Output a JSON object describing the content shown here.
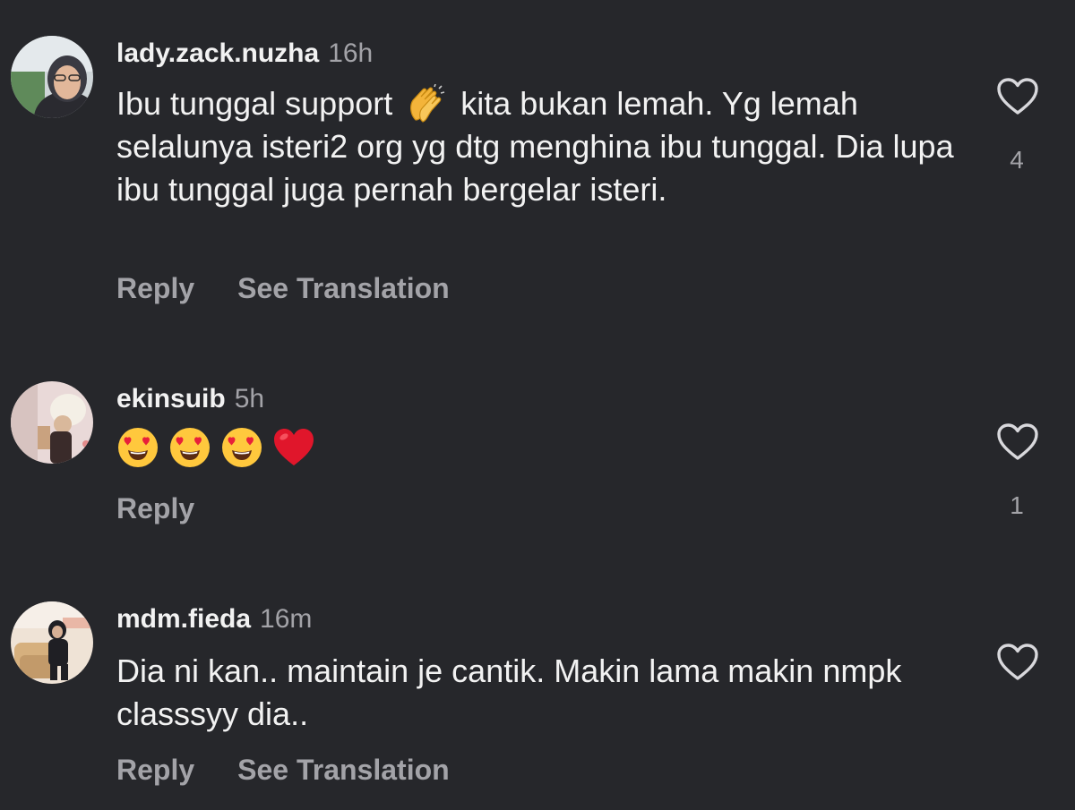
{
  "comments": [
    {
      "username": "lady.zack.nuzha",
      "time": "16h",
      "text_before_emoji": "Ibu tunggal support",
      "emoji": "clapping-hands",
      "text_after_emoji": "kita bukan lemah. Yg lemah selalunya isteri2 org yg dtg menghina ibu tunggal. Dia lupa ibu tunggal juga pernah bergelar isteri.",
      "reply_label": "Reply",
      "translation_label": "See Translation",
      "like_count": "4"
    },
    {
      "username": "ekinsuib",
      "time": "5h",
      "emojis": [
        "heart-eyes-face",
        "heart-eyes-face",
        "heart-eyes-face",
        "red-heart"
      ],
      "reply_label": "Reply",
      "like_count": "1"
    },
    {
      "username": "mdm.fieda",
      "time": "16m",
      "text": "Dia ni kan.. maintain je cantik. Makin lama makin nmpk classsyy dia..",
      "reply_label": "Reply",
      "translation_label": "See Translation"
    }
  ],
  "colors": {
    "background": "#26272b",
    "primary_text": "#f2f2f2",
    "secondary_text": "#a3a3a8"
  }
}
